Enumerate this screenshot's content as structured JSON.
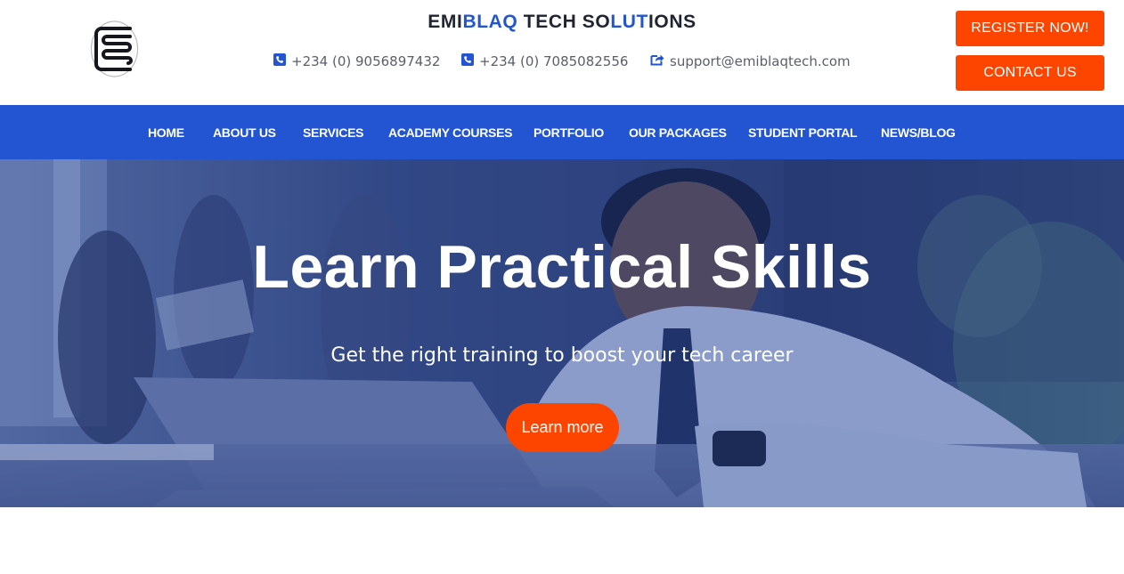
{
  "header": {
    "brand": {
      "parts": [
        {
          "text": "EMI",
          "accent": false
        },
        {
          "text": "BLAQ",
          "accent": true
        },
        {
          "text": " TECH SO",
          "accent": false
        },
        {
          "text": "LUT",
          "accent": true
        },
        {
          "text": "IONS",
          "accent": false
        }
      ]
    },
    "contacts": {
      "phone1": "+234 (0) 9056897432",
      "phone2": "+234 (0) 7085082556",
      "email": "support@emiblaqtech.com"
    },
    "register_label": "REGISTER NOW!",
    "contact_label": "CONTACT US"
  },
  "nav": {
    "items": [
      {
        "label": "HOME"
      },
      {
        "label": "ABOUT US"
      },
      {
        "label": "SERVICES"
      },
      {
        "label": "ACADEMY COURSES"
      },
      {
        "label": "PORTFOLIO"
      },
      {
        "label": "OUR PACKAGES"
      },
      {
        "label": "STUDENT PORTAL"
      },
      {
        "label": "NEWS/BLOG"
      }
    ]
  },
  "hero": {
    "title": "Learn Practical Skills",
    "subtitle": "Get the right training to boost your tech career",
    "button_label": "Learn more"
  },
  "colors": {
    "accent_blue": "#2354d1",
    "cta_orange": "#fe4500",
    "brand_dark": "#1f2430"
  },
  "icons": {
    "phone": "phone-icon",
    "email": "share-email-icon",
    "logo": "logo-icon"
  }
}
